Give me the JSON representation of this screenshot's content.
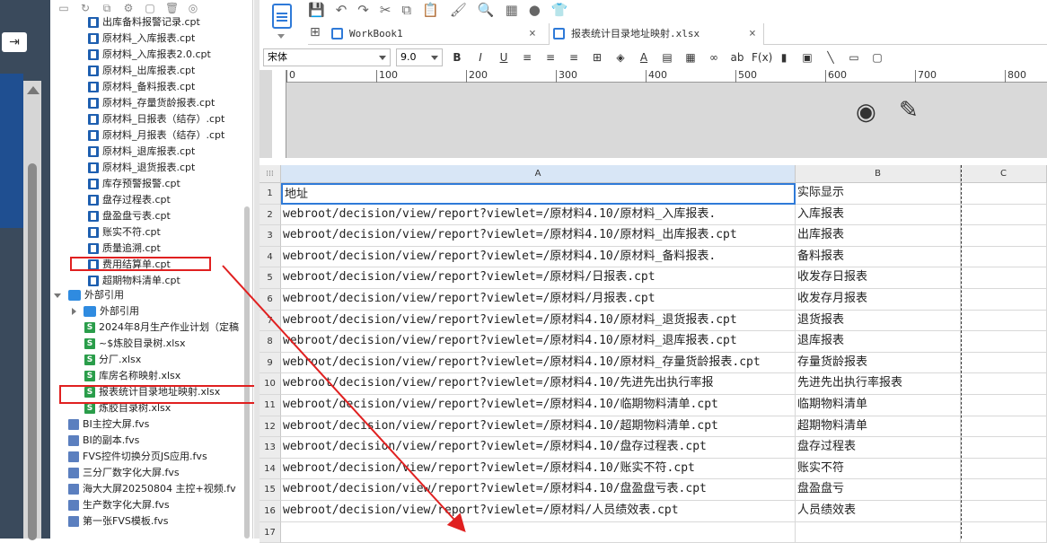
{
  "tree": {
    "items": [
      {
        "label": "出库备料报警记录.cpt",
        "type": "cpt"
      },
      {
        "label": "原材料_入库报表.cpt",
        "type": "cpt"
      },
      {
        "label": "原材料_入库报表2.0.cpt",
        "type": "cpt"
      },
      {
        "label": "原材料_出库报表.cpt",
        "type": "cpt"
      },
      {
        "label": "原材料_备料报表.cpt",
        "type": "cpt"
      },
      {
        "label": "原材料_存量货龄报表.cpt",
        "type": "cpt"
      },
      {
        "label": "原材料_日报表（结存）.cpt",
        "type": "cpt"
      },
      {
        "label": "原材料_月报表（结存）.cpt",
        "type": "cpt"
      },
      {
        "label": "原材料_退库报表.cpt",
        "type": "cpt"
      },
      {
        "label": "原材料_退货报表.cpt",
        "type": "cpt"
      },
      {
        "label": "库存预警报警.cpt",
        "type": "cpt"
      },
      {
        "label": "盘存过程表.cpt",
        "type": "cpt"
      },
      {
        "label": "盘盈盘亏表.cpt",
        "type": "cpt"
      },
      {
        "label": "账实不符.cpt",
        "type": "cpt"
      },
      {
        "label": "质量追溯.cpt",
        "type": "cpt"
      },
      {
        "label": "费用结算单.cpt",
        "type": "cpt"
      },
      {
        "label": "超期物料清单.cpt",
        "type": "cpt"
      },
      {
        "label": "外部引用",
        "type": "folder-open"
      },
      {
        "label": "外部引用",
        "type": "folder-closed"
      },
      {
        "label": "2024年8月生产作业计划（定稿",
        "type": "xlsx"
      },
      {
        "label": "~$炼胶目录树.xlsx",
        "type": "xlsx"
      },
      {
        "label": "分厂.xlsx",
        "type": "xlsx"
      },
      {
        "label": "库房名称映射.xlsx",
        "type": "xlsx"
      },
      {
        "label": "报表统计目录地址映射.xlsx",
        "type": "xlsx"
      },
      {
        "label": "炼胶目录树.xlsx",
        "type": "xlsx"
      },
      {
        "label": "BI主控大屏.fvs",
        "type": "fvs"
      },
      {
        "label": "BI的副本.fvs",
        "type": "fvs"
      },
      {
        "label": "FVS控件切换分页JS应用.fvs",
        "type": "fvs"
      },
      {
        "label": "三分厂数字化大屏.fvs",
        "type": "fvs"
      },
      {
        "label": "海大大屏20250804 主控+视频.fv",
        "type": "fvs"
      },
      {
        "label": "生产数字化大屏.fvs",
        "type": "fvs"
      },
      {
        "label": "第一张FVS模板.fvs",
        "type": "fvs"
      }
    ]
  },
  "tabs": [
    {
      "label": "WorkBook1",
      "close": "×"
    },
    {
      "label": "报表统计目录地址映射.xlsx",
      "close": "×"
    }
  ],
  "format": {
    "font": "宋体",
    "size": "9.0",
    "bold": "B",
    "italic": "I",
    "underline": "U",
    "abc": "ab",
    "fx": "F(x)"
  },
  "ruler": [
    "0",
    "100",
    "200",
    "300",
    "400",
    "500",
    "600",
    "700",
    "800"
  ],
  "sheet": {
    "columns": [
      "A",
      "B",
      "C"
    ],
    "rows": [
      {
        "n": "1",
        "a": "地址",
        "b": "实际显示"
      },
      {
        "n": "2",
        "a": "webroot/decision/view/report?viewlet=/原材料4.10/原材料_入库报表.",
        "b": "入库报表"
      },
      {
        "n": "3",
        "a": "webroot/decision/view/report?viewlet=/原材料4.10/原材料_出库报表.cpt",
        "b": "出库报表"
      },
      {
        "n": "4",
        "a": "webroot/decision/view/report?viewlet=/原材料4.10/原材料_备料报表.",
        "b": "备料报表"
      },
      {
        "n": "5",
        "a": "webroot/decision/view/report?viewlet=/原材料/日报表.cpt",
        "b": "收发存日报表"
      },
      {
        "n": "6",
        "a": "webroot/decision/view/report?viewlet=/原材料/月报表.cpt",
        "b": "收发存月报表"
      },
      {
        "n": "7",
        "a": "webroot/decision/view/report?viewlet=/原材料4.10/原材料_退货报表.cpt",
        "b": "退货报表"
      },
      {
        "n": "8",
        "a": "webroot/decision/view/report?viewlet=/原材料4.10/原材料_退库报表.cpt",
        "b": "退库报表"
      },
      {
        "n": "9",
        "a": "webroot/decision/view/report?viewlet=/原材料4.10/原材料_存量货龄报表.cpt",
        "b": "存量货龄报表"
      },
      {
        "n": "10",
        "a": "webroot/decision/view/report?viewlet=/原材料4.10/先进先出执行率报",
        "b": "先进先出执行率报表"
      },
      {
        "n": "11",
        "a": "webroot/decision/view/report?viewlet=/原材料4.10/临期物料清单.cpt",
        "b": "临期物料清单"
      },
      {
        "n": "12",
        "a": "webroot/decision/view/report?viewlet=/原材料4.10/超期物料清单.cpt",
        "b": "超期物料清单"
      },
      {
        "n": "13",
        "a": "webroot/decision/view/report?viewlet=/原材料4.10/盘存过程表.cpt",
        "b": "盘存过程表"
      },
      {
        "n": "14",
        "a": "webroot/decision/view/report?viewlet=/原材料4.10/账实不符.cpt",
        "b": "账实不符"
      },
      {
        "n": "15",
        "a": "webroot/decision/view/report?viewlet=/原材料4.10/盘盈盘亏表.cpt",
        "b": "盘盈盘亏"
      },
      {
        "n": "16",
        "a": "webroot/decision/view/report?viewlet=/原材料/人员绩效表.cpt",
        "b": "人员绩效表"
      },
      {
        "n": "17",
        "a": "",
        "b": ""
      }
    ]
  },
  "colors": {
    "highlight": "#e02020",
    "accent": "#2f7ad8"
  }
}
